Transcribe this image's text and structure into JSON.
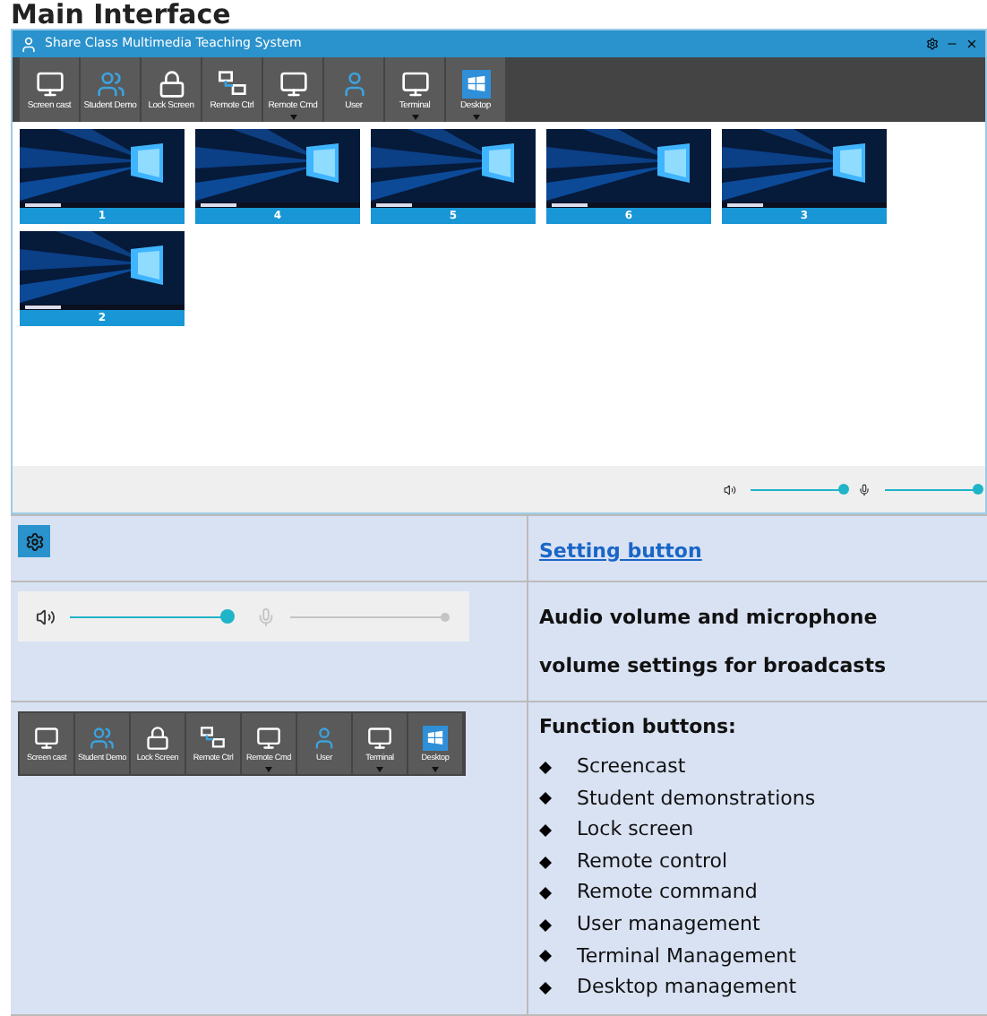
{
  "heading": "Main Interface",
  "window": {
    "title": "Share Class Multimedia Teaching System"
  },
  "toolbar": [
    {
      "label": "Screen cast",
      "kind": "cast",
      "dropdown": false
    },
    {
      "label": "Student Demo",
      "kind": "student",
      "dropdown": false
    },
    {
      "label": "Lock Screen",
      "kind": "lock",
      "dropdown": false
    },
    {
      "label": "Remote Ctrl",
      "kind": "remote",
      "dropdown": false
    },
    {
      "label": "Remote Cmd",
      "kind": "cmd",
      "dropdown": true
    },
    {
      "label": "User",
      "kind": "user",
      "dropdown": false
    },
    {
      "label": "Terminal",
      "kind": "terminal",
      "dropdown": true
    },
    {
      "label": "Desktop",
      "kind": "desktop",
      "dropdown": true
    }
  ],
  "screens": [
    {
      "label": "1"
    },
    {
      "label": "4"
    },
    {
      "label": "5"
    },
    {
      "label": "6"
    },
    {
      "label": "3"
    },
    {
      "label": "2"
    }
  ],
  "volume_bar": {
    "speaker": {
      "level": 1,
      "disabled": false
    },
    "mic": {
      "level": 1,
      "disabled": false
    }
  },
  "table": {
    "rows": [
      {
        "kind": "settings",
        "link": "Setting button"
      },
      {
        "kind": "volume",
        "speaker": {
          "level": 1,
          "disabled": false
        },
        "mic": {
          "level": 1,
          "disabled": true
        },
        "text": "Audio volume and microphone volume settings for broadcasts"
      },
      {
        "kind": "functions",
        "toolbar": [
          {
            "label": "Screen cast",
            "kind": "cast",
            "dropdown": false
          },
          {
            "label": "Student Demo",
            "kind": "student",
            "dropdown": false
          },
          {
            "label": "Lock Screen",
            "kind": "lock",
            "dropdown": false
          },
          {
            "label": "Remote Ctrl",
            "kind": "remote",
            "dropdown": false
          },
          {
            "label": "Remote Cmd",
            "kind": "cmd",
            "dropdown": true
          },
          {
            "label": "User",
            "kind": "user",
            "dropdown": false
          },
          {
            "label": "Terminal",
            "kind": "terminal",
            "dropdown": true
          },
          {
            "label": "Desktop",
            "kind": "desktop",
            "dropdown": true
          }
        ],
        "title": "Function buttons:",
        "items": [
          "Screencast",
          "Student demonstrations",
          "Lock screen",
          "Remote control",
          "Remote command",
          "User management",
          "Terminal Management",
          "Desktop management"
        ]
      }
    ]
  }
}
